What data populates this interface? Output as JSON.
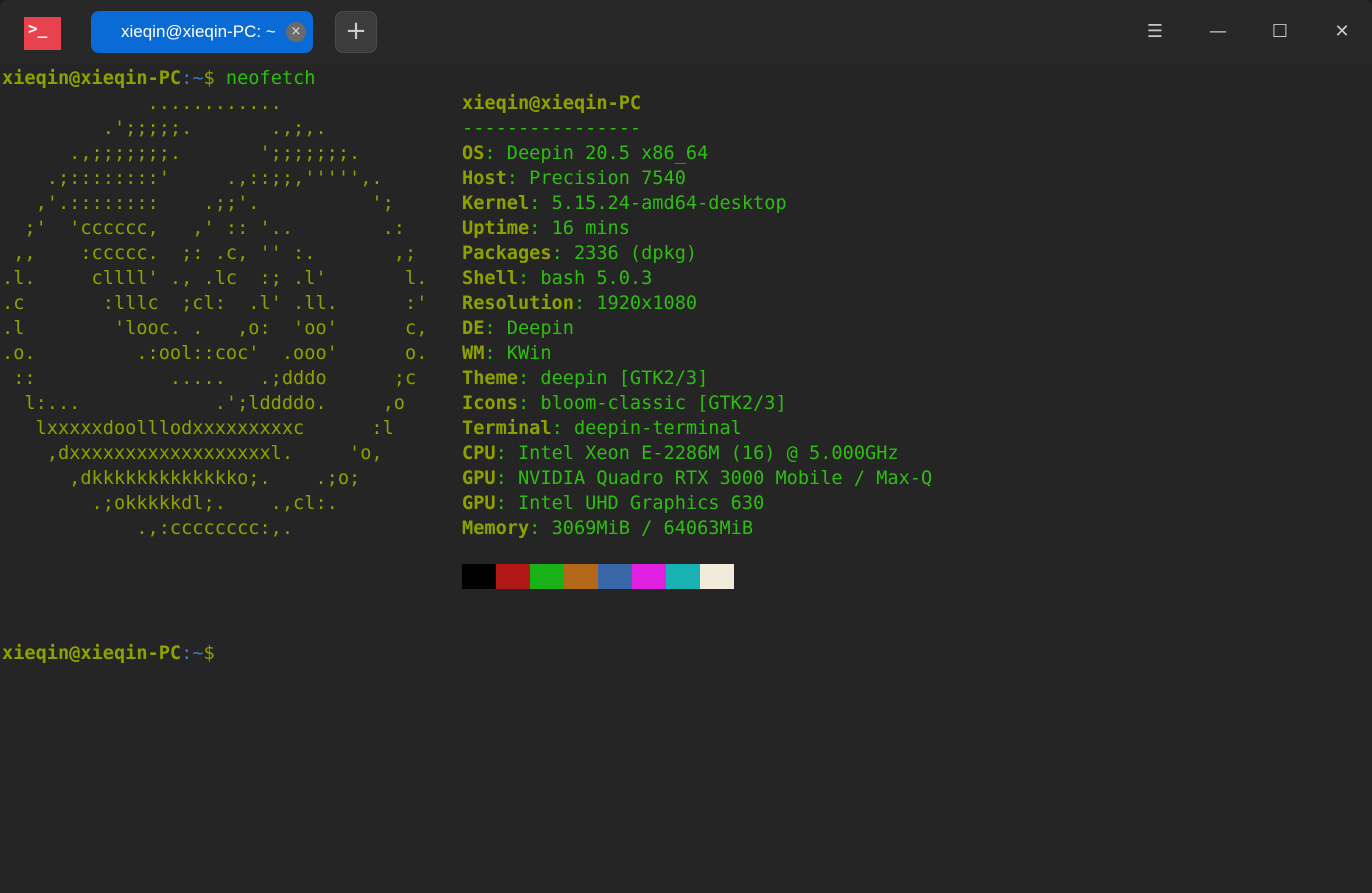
{
  "titlebar": {
    "tab_title": "xieqin@xieqin-PC: ~",
    "app_icon": ">_",
    "close_glyph": "×",
    "add_glyph": "+",
    "menu_glyph": "☰",
    "min_glyph": "—",
    "max_glyph": "☐",
    "close_window_glyph": "✕"
  },
  "prompt": {
    "user_host": "xieqin@xieqin-PC",
    "path": ":~",
    "dollar": "$",
    "command": " neofetch"
  },
  "ascii": [
    "             ............",
    "         .';;;;;.       .,;,.",
    "      .,;;;;;;;.       ';;;;;;;.",
    "    .;::::::::'     .,::;;,''''',.",
    "   ,'.::::::::    .;;'.          ';",
    "  ;'  'cccccc,   ,' :: '..        .:",
    " ,,    :ccccc.  ;: .c, '' :.       ,;",
    ".l.     cllll' ., .lc  :; .l'       l.",
    ".c       :lllc  ;cl:  .l' .ll.      :'",
    ".l        'looc. .   ,o:  'oo'      c,",
    ".o.         .:ool::coc'  .ooo'      o.",
    " ::            .....   .;dddo      ;c",
    "  l:...            .';lddddo.     ,o",
    "   lxxxxxdoolllodxxxxxxxxxc      :l",
    "    ,dxxxxxxxxxxxxxxxxxxl.     'o,",
    "      ,dkkkkkkkkkkkkko;.    .;o;",
    "        .;okkkkkdl;.    .,cl:.",
    "            .,:cccccccc:,."
  ],
  "info": {
    "title": "xieqin@xieqin-PC",
    "separator": "----------------",
    "rows": [
      {
        "key": "OS",
        "value": "Deepin 20.5 x86_64"
      },
      {
        "key": "Host",
        "value": "Precision 7540"
      },
      {
        "key": "Kernel",
        "value": "5.15.24-amd64-desktop"
      },
      {
        "key": "Uptime",
        "value": "16 mins"
      },
      {
        "key": "Packages",
        "value": "2336 (dpkg)"
      },
      {
        "key": "Shell",
        "value": "bash 5.0.3"
      },
      {
        "key": "Resolution",
        "value": "1920x1080"
      },
      {
        "key": "DE",
        "value": "Deepin"
      },
      {
        "key": "WM",
        "value": "KWin"
      },
      {
        "key": "Theme",
        "value": "deepin [GTK2/3]"
      },
      {
        "key": "Icons",
        "value": "bloom-classic [GTK2/3]"
      },
      {
        "key": "Terminal",
        "value": "deepin-terminal"
      },
      {
        "key": "CPU",
        "value": "Intel Xeon E-2286M (16) @ 5.000GHz"
      },
      {
        "key": "GPU",
        "value": "NVIDIA Quadro RTX 3000 Mobile / Max-Q"
      },
      {
        "key": "GPU",
        "value": "Intel UHD Graphics 630"
      },
      {
        "key": "Memory",
        "value": "3069MiB / 64063MiB"
      }
    ]
  },
  "palette": [
    "#000000",
    "#b21818",
    "#18b218",
    "#b26818",
    "#3a67a8",
    "#e020e0",
    "#18b2b2",
    "#f2ebdc"
  ]
}
